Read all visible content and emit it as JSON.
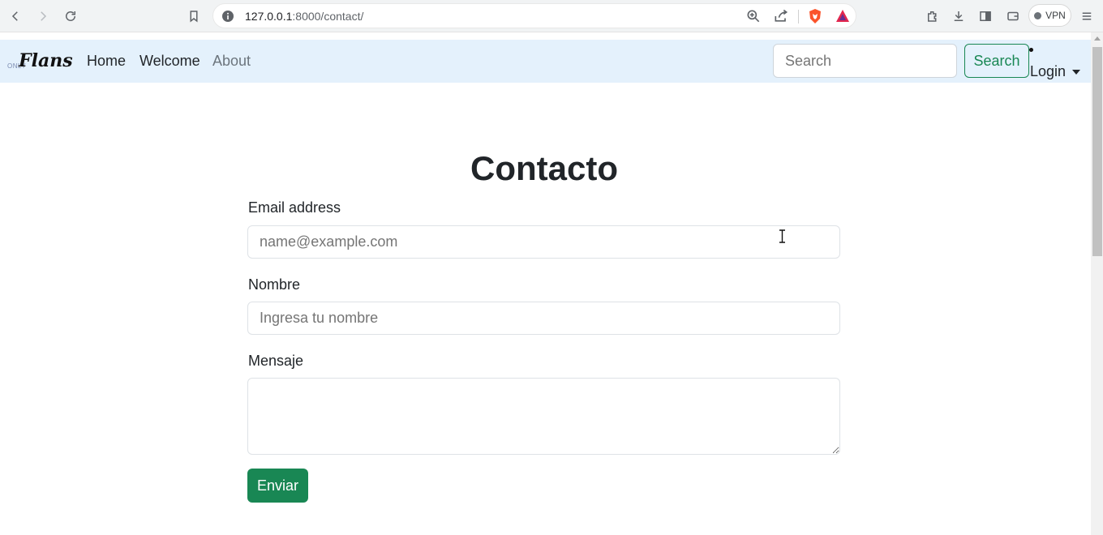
{
  "browser": {
    "url_host": "127.0.0.1",
    "url_path": ":8000/contact/",
    "vpn_label": "VPN"
  },
  "navbar": {
    "logo_small": "ONLY",
    "logo_main": "Flans",
    "links": [
      {
        "label": "Home"
      },
      {
        "label": "Welcome"
      },
      {
        "label": "About"
      }
    ],
    "search_placeholder": "Search",
    "search_button": "Search",
    "login_label": "Login"
  },
  "form": {
    "title": "Contacto",
    "email_label": "Email address",
    "email_placeholder": "name@example.com",
    "name_label": "Nombre",
    "name_placeholder": "Ingresa tu nombre",
    "message_label": "Mensaje",
    "submit_label": "Enviar"
  },
  "colors": {
    "navbar_bg": "#e4f1fc",
    "accent_green": "#198754"
  }
}
